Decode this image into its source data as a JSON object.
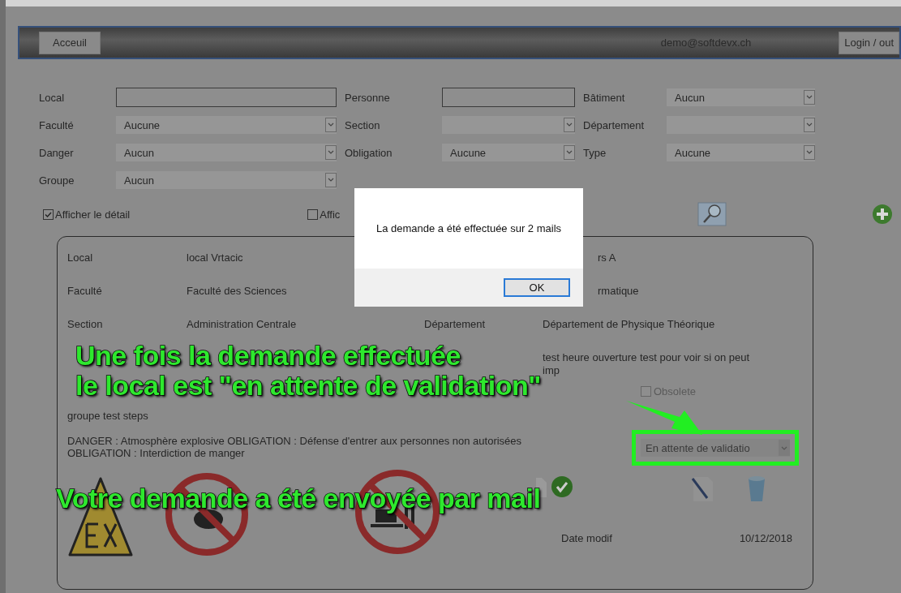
{
  "nav": {
    "home_button": "Acceuil",
    "user_email": "demo@softdevx.ch",
    "login_button": "Login / out"
  },
  "filters": [
    {
      "label": "Local",
      "kind": "text"
    },
    {
      "label": "Personne",
      "kind": "text"
    },
    {
      "label": "Bâtiment",
      "kind": "select",
      "value": "Aucun"
    },
    {
      "label": "Faculté",
      "kind": "select",
      "value": "Aucune"
    },
    {
      "label": "Section",
      "kind": "select"
    },
    {
      "label": "Département",
      "kind": "select"
    },
    {
      "label": "Danger",
      "kind": "select",
      "value": "Aucun"
    },
    {
      "label": "Obligation",
      "kind": "select",
      "value": "Aucune"
    },
    {
      "label": "Type",
      "kind": "select",
      "value": "Aucune"
    },
    {
      "label": "Groupe",
      "kind": "select",
      "value": "Aucun"
    }
  ],
  "options": [
    {
      "label": "Afficher le détail",
      "checked": true
    },
    {
      "label": "Affic",
      "checked": false
    }
  ],
  "card": {
    "fields": [
      {
        "label": "Local",
        "value": "local Vrtacic",
        "side_value": "rs A"
      },
      {
        "label": "Faculté",
        "value": "Faculté des Sciences",
        "side_value": "rmatique"
      },
      {
        "label": "Section",
        "value": "Administration Centrale",
        "side_label": "Département",
        "side_value": "Département de Physique Théorique"
      },
      {
        "side_value": "test heure ouverture test pour voir si on peut imp"
      }
    ],
    "obsolete": {
      "label": "Obsolete",
      "checked": false
    },
    "group": "groupe test steps",
    "hazards": "DANGER : Atmosphère explosive OBLIGATION : Défense d'entrer aux personnes non autorisées OBLIGATION : Interdiction de manger",
    "status": {
      "value": "En attente de validatio",
      "highlighted": true
    },
    "date_label": "Date modif",
    "date_value": "10/12/2018"
  },
  "dialog": {
    "message": "La demande a été effectuée sur 2 mails",
    "button": "OK"
  },
  "annotations": [
    {
      "text": "Une fois la demande effectuée\nle local est \"en attente de validation\"",
      "kind": "top"
    },
    {
      "text": "Votre demande a été envoyée par mail",
      "kind": "bottom"
    }
  ]
}
